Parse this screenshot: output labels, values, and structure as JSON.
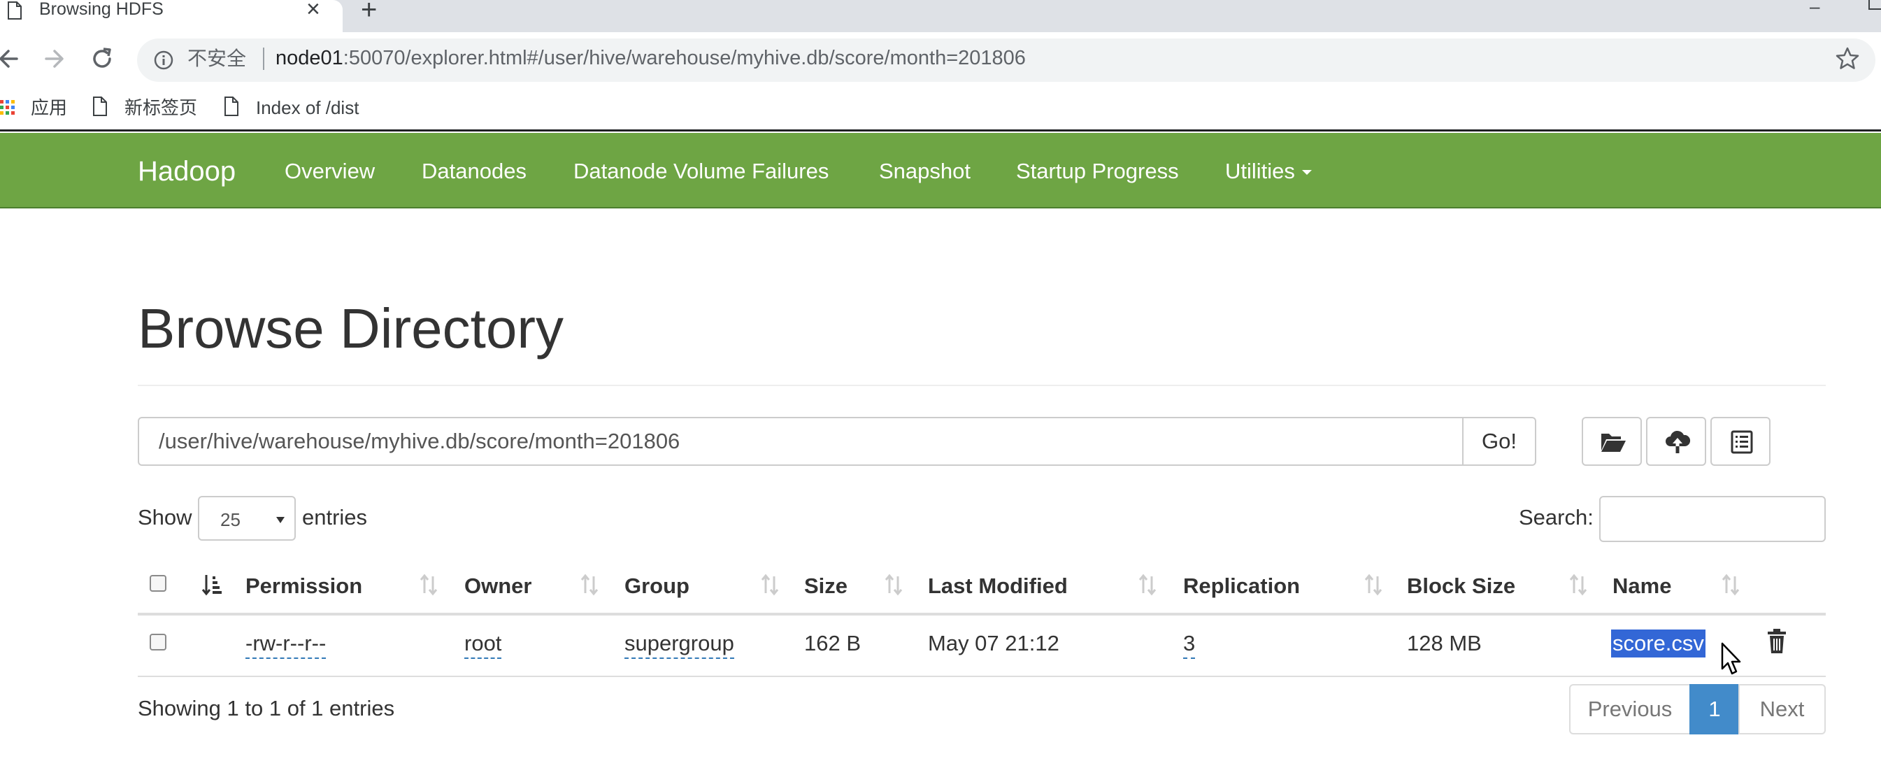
{
  "browser": {
    "tab_title": "Browsing HDFS",
    "tab_close": "×",
    "new_tab": "+",
    "minimize": "–",
    "insecure_label": "不安全",
    "url_host": "node01",
    "url_rest": ":50070/explorer.html#/user/hive/warehouse/myhive.db/score/month=201806",
    "bookmarks": [
      "应用",
      "新标签页",
      "Index of /dist"
    ]
  },
  "navbar": {
    "brand": "Hadoop",
    "links": [
      "Overview",
      "Datanodes",
      "Datanode Volume Failures",
      "Snapshot",
      "Startup Progress",
      "Utilities"
    ]
  },
  "page": {
    "title": "Browse Directory",
    "path_value": "/user/hive/warehouse/myhive.db/score/month=201806",
    "go_label": "Go!",
    "show_label": "Show",
    "entries_label": "entries",
    "page_length": "25",
    "search_label": "Search:"
  },
  "table": {
    "columns": [
      "Permission",
      "Owner",
      "Group",
      "Size",
      "Last Modified",
      "Replication",
      "Block Size",
      "Name"
    ],
    "rows": [
      {
        "permission": "-rw-r--r--",
        "owner": "root",
        "group": "supergroup",
        "size": "162 B",
        "last_modified": "May 07 21:12",
        "replication": "3",
        "block_size": "128 MB",
        "name": "score.csv"
      }
    ]
  },
  "footer": {
    "info": "Showing 1 to 1 of 1 entries",
    "previous": "Previous",
    "current_page": "1",
    "next": "Next"
  },
  "colors": {
    "navbar": "#6ea544",
    "pager_active": "#428bca",
    "selection": "#3367d6"
  }
}
